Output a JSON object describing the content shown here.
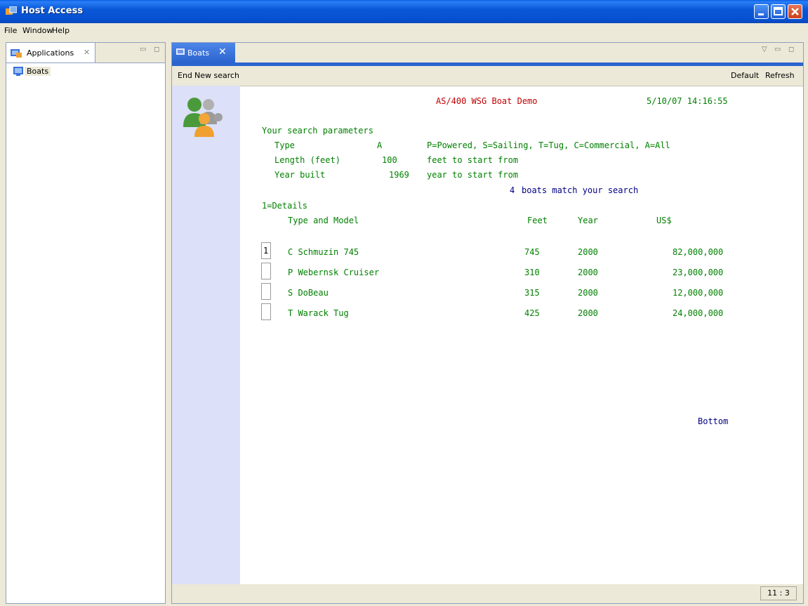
{
  "window": {
    "title": "Host Access"
  },
  "menu": [
    "File",
    "Window",
    "Help"
  ],
  "left_panel": {
    "tab_label": "Applications",
    "items": [
      "Boats"
    ]
  },
  "editor": {
    "tab_label": "Boats"
  },
  "toolbar": {
    "end": "End",
    "new_search": "New search",
    "default": "Default",
    "refresh": "Refresh"
  },
  "screen": {
    "title": "AS/400 WSG Boat Demo",
    "datetime": "5/10/07 14:16:55",
    "params_heading": "Your search parameters",
    "params": [
      {
        "label": "Type",
        "value": "A",
        "hint": "P=Powered, S=Sailing, T=Tug, C=Commercial, A=All"
      },
      {
        "label": "Length (feet)",
        "value": "100",
        "hint": "feet to start from"
      },
      {
        "label": "Year built",
        "value": "1969",
        "hint": "year to start from"
      }
    ],
    "match_count": "4",
    "match_text": "boats match your search",
    "options_hint": "1=Details",
    "columns": {
      "model": "Type and Model",
      "feet": "Feet",
      "year": "Year",
      "price": "US$"
    },
    "rows": [
      {
        "option": "1",
        "model": "C Schmuzin 745",
        "feet": "745",
        "year": "2000",
        "price": "82,000,000"
      },
      {
        "option": "",
        "model": "P Webernsk Cruiser",
        "feet": "310",
        "year": "2000",
        "price": "23,000,000"
      },
      {
        "option": "",
        "model": "S DoBeau",
        "feet": "315",
        "year": "2000",
        "price": "12,000,000"
      },
      {
        "option": "",
        "model": "T Warack Tug",
        "feet": "425",
        "year": "2000",
        "price": "24,000,000"
      }
    ],
    "bottom_marker": "Bottom"
  },
  "status": {
    "cursor": "11 : 3"
  }
}
